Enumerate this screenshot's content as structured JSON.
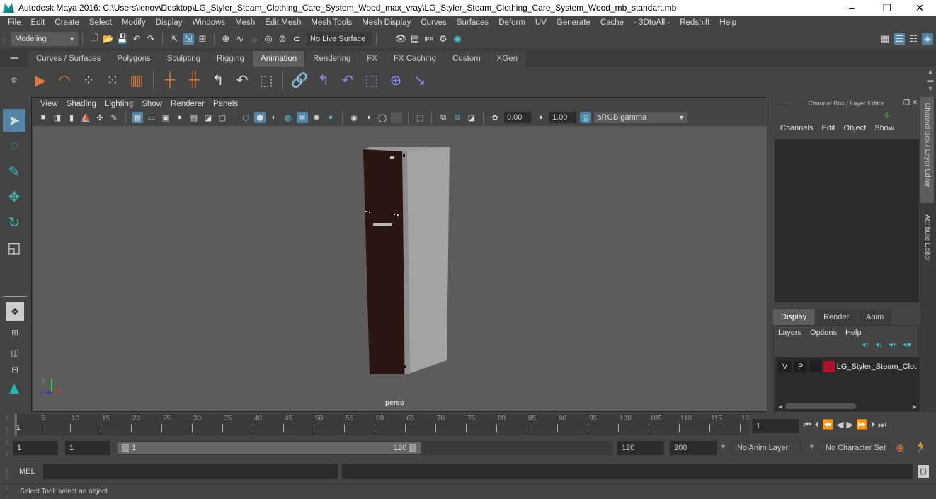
{
  "window": {
    "title": "Autodesk Maya 2016: C:\\Users\\lenov\\Desktop\\LG_Styler_Steam_Clothing_Care_System_Wood_max_vray\\LG_Styler_Steam_Clothing_Care_System_Wood_mb_standart.mb",
    "minimize": "–",
    "maximize": "❐",
    "close": "✕"
  },
  "menubar": [
    "File",
    "Edit",
    "Create",
    "Select",
    "Modify",
    "Display",
    "Windows",
    "Mesh",
    "Edit Mesh",
    "Mesh Tools",
    "Mesh Display",
    "Curves",
    "Surfaces",
    "Deform",
    "UV",
    "Generate",
    "Cache",
    "- 3DtoAll -",
    "Redshift",
    "Help"
  ],
  "statusline": {
    "menuset": "Modeling",
    "live_surface": "No Live Surface"
  },
  "shelf_tabs": [
    {
      "label": "Curves / Surfaces",
      "active": false
    },
    {
      "label": "Polygons",
      "active": false
    },
    {
      "label": "Sculpting",
      "active": false
    },
    {
      "label": "Rigging",
      "active": false
    },
    {
      "label": "Animation",
      "active": true
    },
    {
      "label": "Rendering",
      "active": false
    },
    {
      "label": "FX",
      "active": false
    },
    {
      "label": "FX Caching",
      "active": false
    },
    {
      "label": "Custom",
      "active": false
    },
    {
      "label": "XGen",
      "active": false
    }
  ],
  "viewport": {
    "menu": [
      "View",
      "Shading",
      "Lighting",
      "Show",
      "Renderer",
      "Panels"
    ],
    "exposure": "0.00",
    "gamma": "1.00",
    "color_space": "sRGB gamma",
    "camera_label": "persp",
    "axis": {
      "x": "x",
      "y": "y",
      "z": "z"
    }
  },
  "channel_box": {
    "title": "Channel Box / Layer Editor",
    "menu": [
      "Channels",
      "Edit",
      "Object",
      "Show"
    ]
  },
  "layer_editor": {
    "tabs": [
      {
        "label": "Display",
        "active": true
      },
      {
        "label": "Render",
        "active": false
      },
      {
        "label": "Anim",
        "active": false
      }
    ],
    "menu": [
      "Layers",
      "Options",
      "Help"
    ],
    "layers": [
      {
        "visible": "V",
        "playback": "P",
        "color": "#b0102a",
        "name": "LG_Styler_Steam_Cloth"
      }
    ]
  },
  "side_tabs": [
    "Channel Box / Layer Editor",
    "Attribute Editor"
  ],
  "timeline": {
    "ticks": [
      "5",
      "10",
      "15",
      "20",
      "25",
      "30",
      "35",
      "40",
      "45",
      "50",
      "55",
      "60",
      "65",
      "70",
      "75",
      "80",
      "85",
      "90",
      "95",
      "100",
      "105",
      "110",
      "115",
      "12"
    ],
    "current_frame_marker": "1",
    "current_frame": "1"
  },
  "range": {
    "start": "1",
    "playback_start": "1",
    "slider_start": "1",
    "slider_end": "120",
    "playback_end": "120",
    "end": "200",
    "anim_layer": "No Anim Layer",
    "character_set": "No Character Set"
  },
  "command_line": {
    "label": "MEL"
  },
  "help_line": "Select Tool: select an object",
  "colors": {
    "accent": "#5285a6",
    "orange": "#e07a3c",
    "teal": "#20b5b5",
    "link": "#8e8ee8"
  }
}
